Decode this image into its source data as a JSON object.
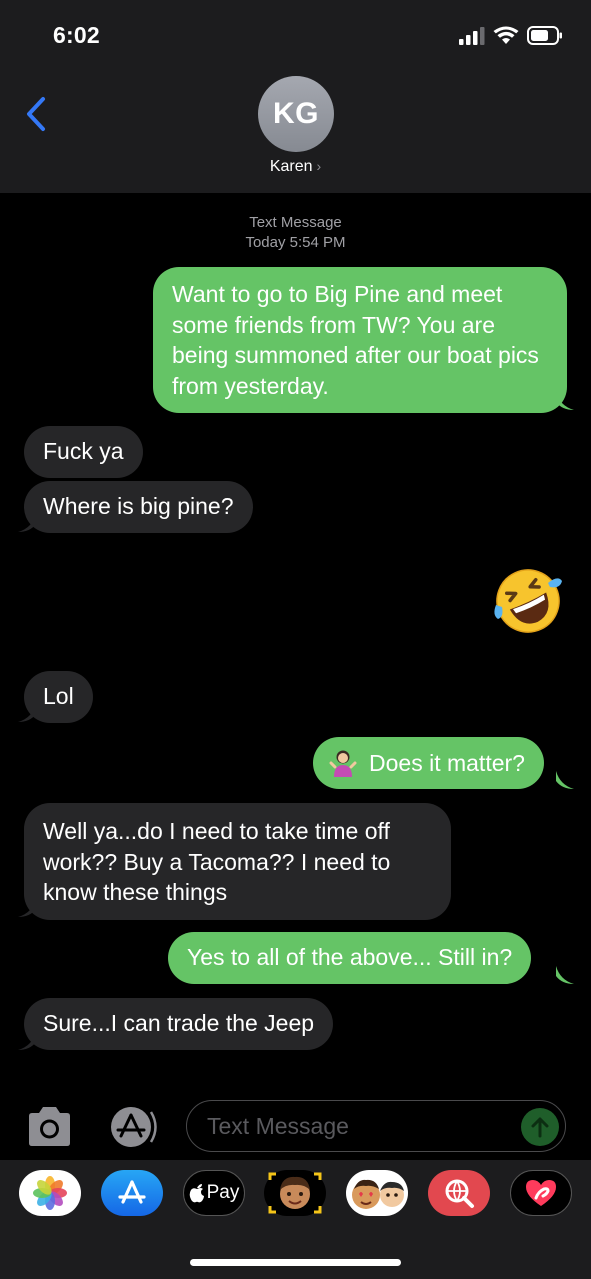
{
  "status_bar": {
    "time": "6:02"
  },
  "header": {
    "avatar_initials": "KG",
    "contact_name": "Karen",
    "chevron": "›"
  },
  "thread": {
    "service": "Text Message",
    "timestamp": "Today 5:54 PM",
    "messages": [
      {
        "from": "me",
        "text": "Want to go to Big Pine and meet some friends from TW? You are being summoned after our boat pics from yesterday."
      },
      {
        "from": "them",
        "text": "Fuck ya"
      },
      {
        "from": "them",
        "text": "Where is big pine?"
      },
      {
        "from": "me",
        "emoji": "rolling-on-floor-laughing"
      },
      {
        "from": "them",
        "text": "Lol"
      },
      {
        "from": "me",
        "emoji_prefix": "person-shrugging",
        "text": "Does it matter?"
      },
      {
        "from": "them",
        "text": "Well ya...do I need to take time off work?? Buy a Tacoma?? I need to know these things"
      },
      {
        "from": "me",
        "text": "Yes to all of the above... Still in?"
      },
      {
        "from": "them",
        "text": "Sure...I can trade the Jeep"
      }
    ]
  },
  "composer": {
    "placeholder": "Text Message"
  },
  "app_drawer": {
    "apps": [
      "photos-icon",
      "app-store-icon",
      "apple-pay-icon",
      "memoji-icon",
      "animoji-stickers-icon",
      "web-search-icon",
      "digital-touch-icon"
    ],
    "apple_pay_label": "Pay"
  },
  "colors": {
    "outgoing": "#65c466",
    "incoming": "#262628",
    "accent": "#3478f6"
  }
}
